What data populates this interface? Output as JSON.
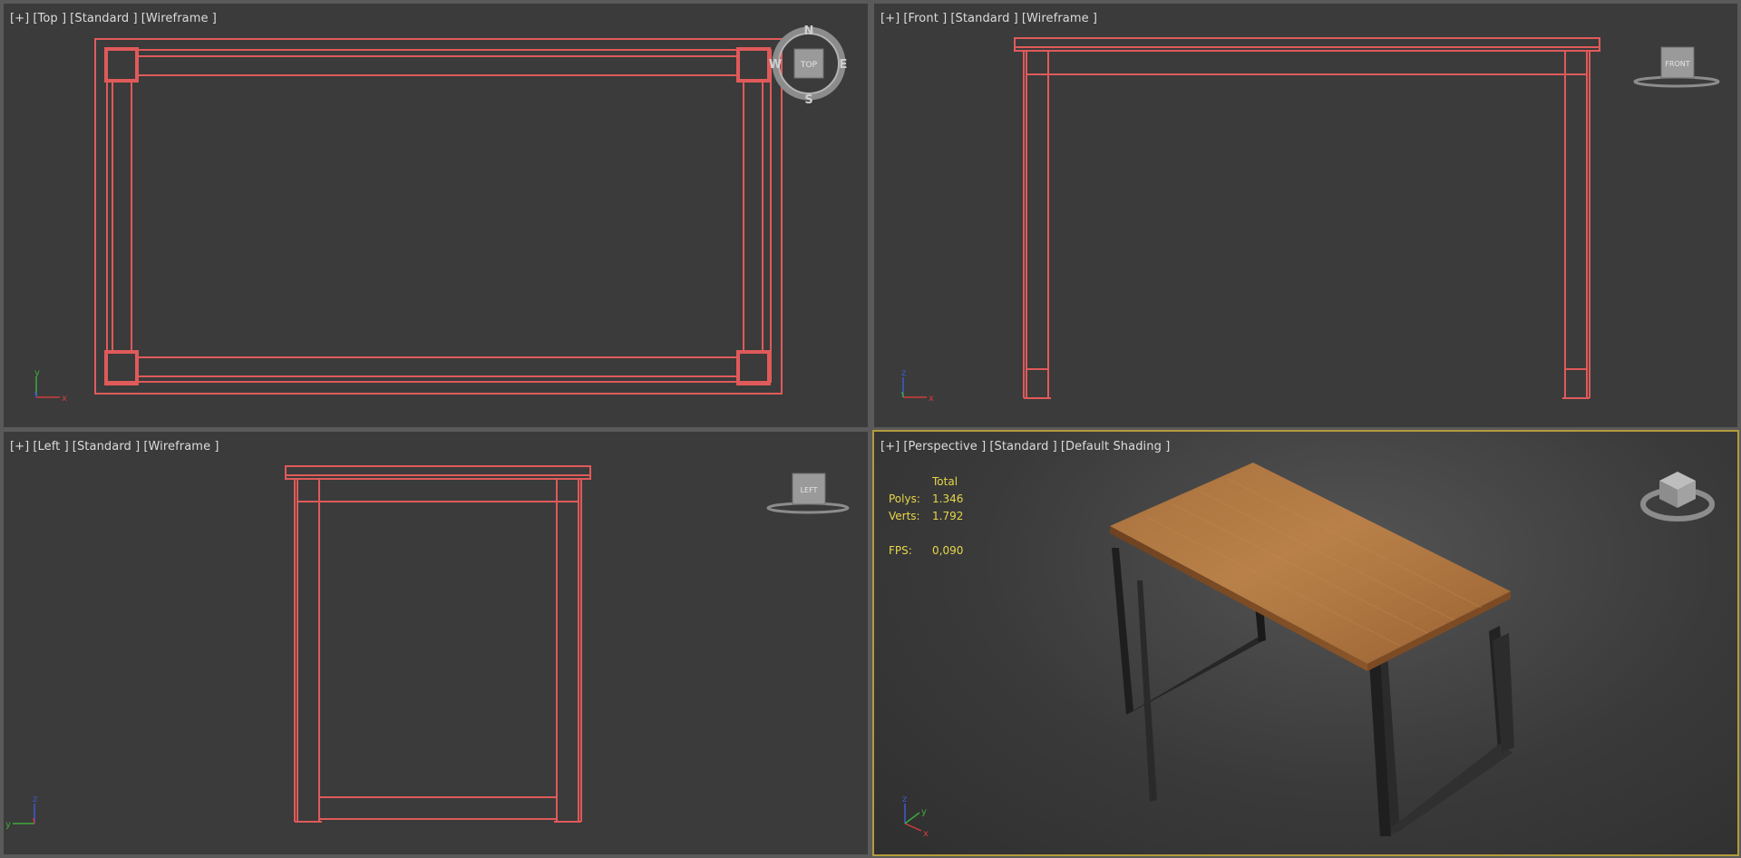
{
  "viewports": {
    "top": {
      "tags": [
        "[+]",
        "[Top ]",
        "[Standard ]",
        "[Wireframe ]"
      ]
    },
    "front": {
      "tags": [
        "[+]",
        "[Front ]",
        "[Standard ]",
        "[Wireframe ]"
      ]
    },
    "left": {
      "tags": [
        "[+]",
        "[Left ]",
        "[Standard ]",
        "[Wireframe ]"
      ]
    },
    "perspective": {
      "tags": [
        "[+]",
        "[Perspective ]",
        "[Standard ]",
        "[Default Shading ]"
      ]
    }
  },
  "stats": {
    "header": "Total",
    "polys_label": "Polys:",
    "polys_value": "1.346",
    "verts_label": "Verts:",
    "verts_value": "1.792",
    "fps_label": "FPS:",
    "fps_value": "0,090"
  },
  "viewcube": {
    "top_face": "TOP",
    "front_face": "FRONT",
    "left_face": "LEFT",
    "compass_n": "N",
    "compass_s": "S",
    "compass_e": "E",
    "compass_w": "W"
  },
  "axes": {
    "top": {
      "v": "y",
      "h": "x"
    },
    "front": {
      "v": "z",
      "h": "x"
    },
    "left": {
      "v": "z",
      "h": "y"
    },
    "persp": {
      "v": "z",
      "d": "y",
      "h": "x"
    }
  },
  "colors": {
    "wire": "#e05a5a",
    "active_border": "#b49b3c",
    "stats": "#e6d64a",
    "axis_x": "#d23c3c",
    "axis_y": "#3caa3c",
    "axis_z": "#3c5ad2"
  }
}
